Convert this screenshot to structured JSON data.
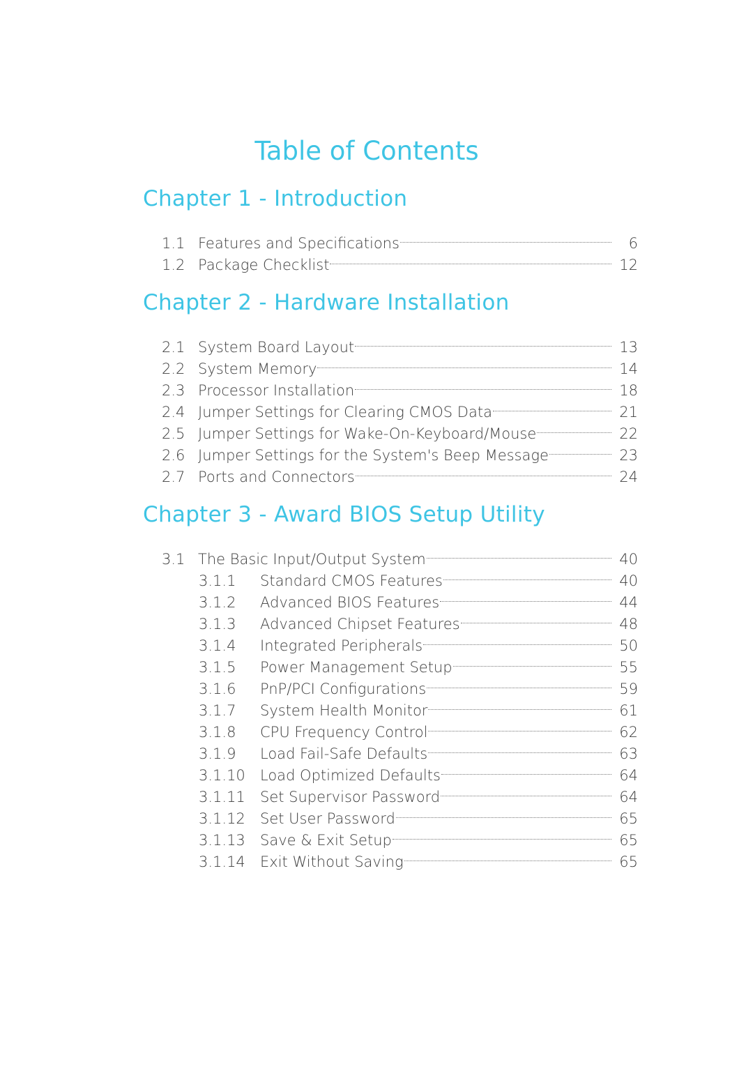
{
  "colors": {
    "accent": "#3ec4e4",
    "text": "#3d3d3d"
  },
  "page_title": "Table of Contents",
  "chapters": [
    {
      "heading": "Chapter 1 - Introduction",
      "entries": [
        {
          "num": "1.1",
          "title": "Features and Specifications",
          "page": "6"
        },
        {
          "num": "1.2",
          "title": "Package Checklist",
          "page": "12"
        }
      ]
    },
    {
      "heading": "Chapter 2 - Hardware Installation",
      "entries": [
        {
          "num": "2.1",
          "title": "System Board Layout",
          "page": "13"
        },
        {
          "num": "2.2",
          "title": "System Memory",
          "page": "14"
        },
        {
          "num": "2.3",
          "title": "Processor Installation",
          "page": "18"
        },
        {
          "num": "2.4",
          "title": "Jumper Settings for Clearing CMOS Data",
          "page": "21"
        },
        {
          "num": "2.5",
          "title": "Jumper Settings for Wake-On-Keyboard/Mouse",
          "page": "22"
        },
        {
          "num": "2.6",
          "title": "Jumper Settings for the System's Beep Message",
          "page": "23"
        },
        {
          "num": "2.7",
          "title": "Ports and Connectors",
          "page": "24"
        }
      ]
    },
    {
      "heading": "Chapter 3 - Award BIOS Setup Utility",
      "entries": [
        {
          "num": "3.1",
          "title": "The Basic Input/Output System",
          "page": "40"
        },
        {
          "num": "3.1.1",
          "title": "Standard CMOS Features",
          "page": "40"
        },
        {
          "num": "3.1.2",
          "title": "Advanced BIOS Features",
          "page": "44"
        },
        {
          "num": "3.1.3",
          "title": "Advanced Chipset Features",
          "page": "48"
        },
        {
          "num": "3.1.4",
          "title": "Integrated Peripherals",
          "page": "50"
        },
        {
          "num": "3.1.5",
          "title": "Power Management Setup",
          "page": "55"
        },
        {
          "num": "3.1.6",
          "title": "PnP/PCI Configurations",
          "page": "59"
        },
        {
          "num": "3.1.7",
          "title": "System Health Monitor",
          "page": "61"
        },
        {
          "num": "3.1.8",
          "title": "CPU Frequency Control",
          "page": "62"
        },
        {
          "num": "3.1.9",
          "title": "Load Fail-Safe Defaults",
          "page": "63"
        },
        {
          "num": "3.1.10",
          "title": "Load Optimized Defaults",
          "page": "64"
        },
        {
          "num": "3.1.11",
          "title": "Set Supervisor Password",
          "page": "64"
        },
        {
          "num": "3.1.12",
          "title": "Set User Password",
          "page": "65"
        },
        {
          "num": "3.1.13",
          "title": "Save & Exit Setup",
          "page": "65"
        },
        {
          "num": "3.1.14",
          "title": "Exit Without Saving",
          "page": "65"
        }
      ]
    }
  ]
}
